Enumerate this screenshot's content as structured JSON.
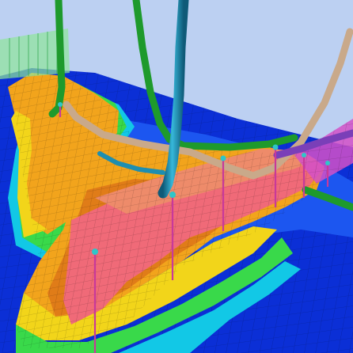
{
  "scene": {
    "kind": "3d-reservoir-grid-view",
    "palette": {
      "sky": "#bcd0f2",
      "deep": "#0b2fd6",
      "mid_blue": "#1c56f0",
      "cyan": "#12c8e6",
      "green": "#39d94a",
      "yellow": "#f2d51a",
      "orange": "#f2a41c",
      "orange_dark": "#e07c18",
      "pink": "#f06a78",
      "salmon": "#ee8b6a",
      "magenta_fence": "#d450c8",
      "well_green": "#1e9a2c",
      "well_teal": "#1e8eb0",
      "well_tan": "#c9a98a",
      "well_purple": "#7a3fb8",
      "marker_pink": "#c8399a",
      "marker_cyan": "#2fc6c8"
    },
    "wells": [
      {
        "name": "green-well-left",
        "color": "well_green"
      },
      {
        "name": "green-well-center",
        "color": "well_green"
      },
      {
        "name": "teal-well",
        "color": "well_teal"
      },
      {
        "name": "tan-well",
        "color": "well_tan"
      },
      {
        "name": "purple-well",
        "color": "well_purple"
      },
      {
        "name": "green-well-right",
        "color": "well_green"
      }
    ],
    "marker_count": 7
  }
}
